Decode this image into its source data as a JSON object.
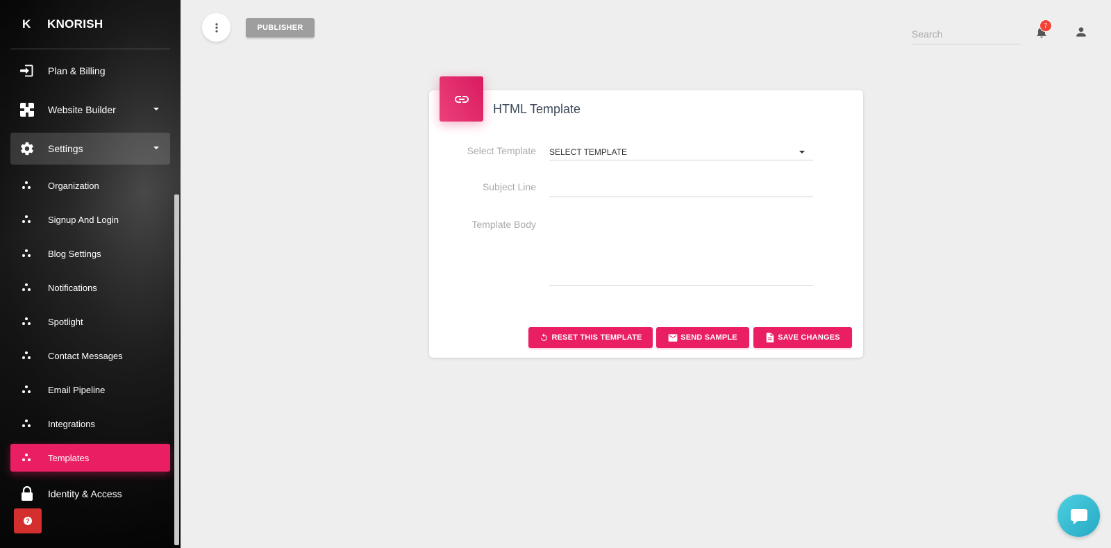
{
  "brand": {
    "mini": "K",
    "name": "KNORISH"
  },
  "sidebar": {
    "main_items": [
      {
        "label": "Plan & Billing",
        "icon": "sign-in-icon"
      },
      {
        "label": "Website Builder",
        "icon": "puzzle-icon"
      },
      {
        "label": "Settings",
        "icon": "gear-icon"
      }
    ],
    "settings_items": [
      {
        "label": "Organization"
      },
      {
        "label": "Signup And Login"
      },
      {
        "label": "Blog Settings"
      },
      {
        "label": "Notifications"
      },
      {
        "label": "Spotlight"
      },
      {
        "label": "Contact Messages"
      },
      {
        "label": "Email Pipeline"
      },
      {
        "label": "Integrations"
      },
      {
        "label": "Templates"
      }
    ],
    "bottom_item": {
      "label": "Identity & Access",
      "icon": "lock-icon"
    }
  },
  "topbar": {
    "publisher_label": "PUBLISHER",
    "search_placeholder": "Search",
    "notification_count": "7"
  },
  "card": {
    "title": "HTML Template",
    "icon": "link-icon",
    "select_template_label": "Select Template",
    "select_template_value": "SELECT TEMPLATE",
    "subject_line_label": "Subject Line",
    "subject_line_value": "",
    "template_body_label": "Template Body",
    "template_body_value": "",
    "buttons": {
      "reset": "RESET THIS TEMPLATE",
      "send": "SEND SAMPLE",
      "save": "SAVE CHANGES"
    }
  },
  "colors": {
    "accent": "#e91e63",
    "badge": "#f44336",
    "chat": "#26a9c4"
  }
}
